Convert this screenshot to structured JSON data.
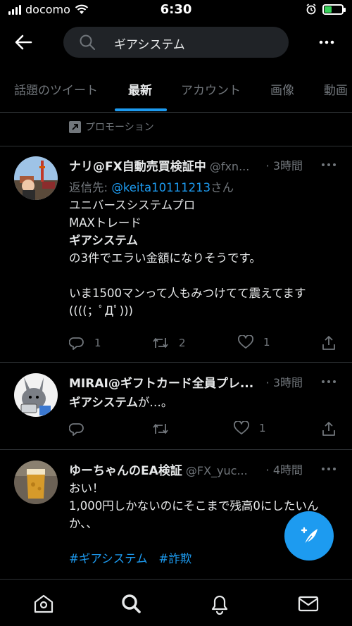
{
  "status_bar": {
    "carrier": "docomo",
    "time": "6:30"
  },
  "search": {
    "query": "ギアシステム"
  },
  "tabs": [
    {
      "label": "話題のツイート"
    },
    {
      "label": "最新"
    },
    {
      "label": "アカウント"
    },
    {
      "label": "画像"
    },
    {
      "label": "動画"
    }
  ],
  "promotion": {
    "label": "プロモーション"
  },
  "tweets": [
    {
      "name": "ナリ@FX自動売買検証中",
      "handle": "@fxn...",
      "time": "· 3時間",
      "reply_prefix": "返信先: ",
      "reply_to": "@keita10111213",
      "reply_suffix": "さん",
      "lines": [
        "ユニバースシステムプロ",
        "MAXトレード",
        "ギアシステム",
        "の3件でエラい金額になりそうです。",
        "",
        "いま1500マンって人もみつけてて震えてます",
        "((((；ﾟДﾟ)))"
      ],
      "replies": "1",
      "retweets": "2",
      "likes": "1"
    },
    {
      "name": "MIRAI@ギフトカード全員プレ...",
      "handle": "",
      "time": "· 3時間",
      "body_bold": "ギアシステム",
      "body_rest": "が…。",
      "replies": "",
      "retweets": "",
      "likes": "1"
    },
    {
      "name": "ゆーちゃんのEA検証",
      "handle": "@FX_yuc...",
      "time": "· 4時間",
      "lines": [
        "おい！",
        "1,000円しかないのにそこまで残高0にしたいん",
        "か、、"
      ],
      "hashtags": [
        "#ギアシステム",
        "#詐欺"
      ]
    }
  ],
  "colors": {
    "accent": "#1d9bf0",
    "background": "#000000",
    "muted": "#71767b"
  },
  "icons": [
    "back-arrow-icon",
    "search-icon",
    "more-icon",
    "promoted-icon",
    "reply-icon",
    "retweet-icon",
    "like-icon",
    "share-icon",
    "compose-icon",
    "home-icon",
    "explore-icon",
    "notifications-icon",
    "messages-icon"
  ]
}
